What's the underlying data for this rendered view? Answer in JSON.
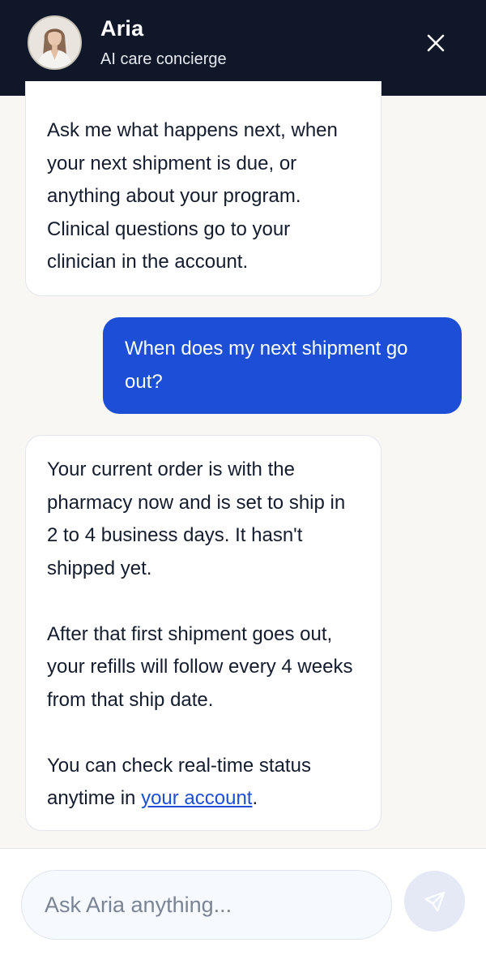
{
  "header": {
    "name": "Aria",
    "subtitle": "AI care concierge",
    "avatar_icon": "avatar-portrait-icon",
    "close_icon": "close-icon"
  },
  "messages": [
    {
      "sender": "assistant",
      "paragraphs": [
        "Ask me what happens next, when your next shipment is due, or anything about your program. Clinical questions go to your clinician in the account."
      ]
    },
    {
      "sender": "user",
      "paragraphs": [
        "When does my next shipment go out?"
      ]
    },
    {
      "sender": "assistant",
      "paragraphs": [
        "Your current order is with the pharmacy now and is set to ship in 2 to 4 business days. It hasn't shipped yet.",
        "After that first shipment goes out, your refills will follow every 4 weeks from that ship date.",
        "You can check real-time status anytime in"
      ],
      "link_text": "your account",
      "link_suffix": "."
    }
  ],
  "composer": {
    "placeholder": "Ask Aria anything...",
    "value": "",
    "send_icon": "send-icon"
  },
  "colors": {
    "header_bg": "#0f1729",
    "user_bubble": "#1c4fd6",
    "page_bg": "#f9f7f3",
    "link": "#1c4fd6"
  }
}
